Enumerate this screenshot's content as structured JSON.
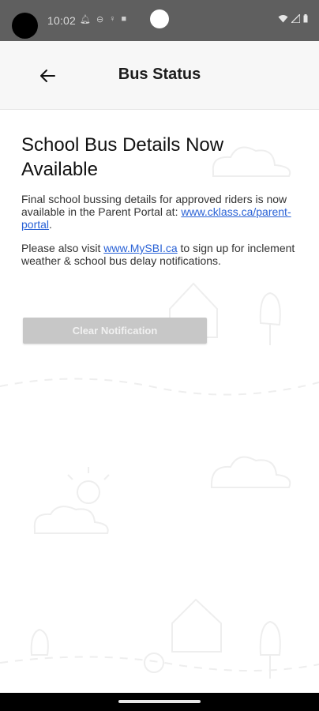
{
  "status_bar": {
    "time": "10:02",
    "icons": [
      "notification-bell-icon",
      "dnd-circle-icon",
      "accessibility-icon",
      "sd-card-icon"
    ],
    "right_icons": [
      "wifi-icon",
      "cell-signal-icon",
      "battery-icon"
    ]
  },
  "app_bar": {
    "title": "Bus Status",
    "back_icon": "arrow-left-icon"
  },
  "notification": {
    "headline": "School Bus Details Now Available",
    "para1_text": "Final school bussing details for approved riders is now available in the Parent Portal at: ",
    "para1_link": "www.cklass.ca/parent-portal",
    "para1_end": ".",
    "para2_prefix": "Please also visit ",
    "para2_link": "www.MySBI.ca",
    "para2_text": " to sign up for inclement weather & school bus delay notifications."
  },
  "button": {
    "clear_label": "Clear Notification"
  },
  "colors": {
    "status_bar_bg": "#5f5f5f",
    "link": "#2a62d6",
    "button_bg": "#c7c7c7"
  }
}
